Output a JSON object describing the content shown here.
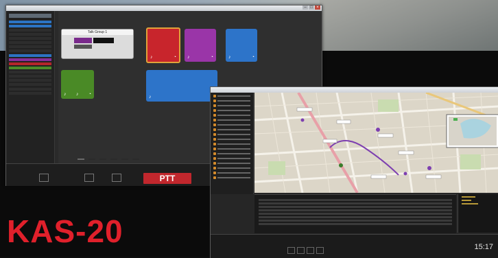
{
  "product": {
    "name": "KAS-20"
  },
  "console": {
    "sidebar": {
      "sections": [
        "",
        "",
        ""
      ]
    },
    "tiles": [
      {
        "id": "talkgroup",
        "label": "Talk Group 1",
        "color": "#dcdcdc"
      },
      {
        "id": "red",
        "label": "",
        "color": "#c8252c"
      },
      {
        "id": "purple",
        "label": "",
        "color": "#9a35a8"
      },
      {
        "id": "blue-small",
        "label": "",
        "color": "#2d74c9"
      },
      {
        "id": "green",
        "label": "",
        "color": "#4a8a26"
      },
      {
        "id": "blue-wide",
        "label": "",
        "color": "#2d74c9"
      }
    ],
    "ptt_label": "PTT",
    "accent": "#c1272d"
  },
  "map_window": {
    "clock": "15:17",
    "nav_buttons": [
      "",
      "",
      "",
      ""
    ],
    "map_colors": {
      "land": "#d9d4c9",
      "road": "#f3f0e8",
      "water": "#aad3df",
      "route": "#7d3fb0",
      "main_road": "#e8a0a8"
    }
  }
}
